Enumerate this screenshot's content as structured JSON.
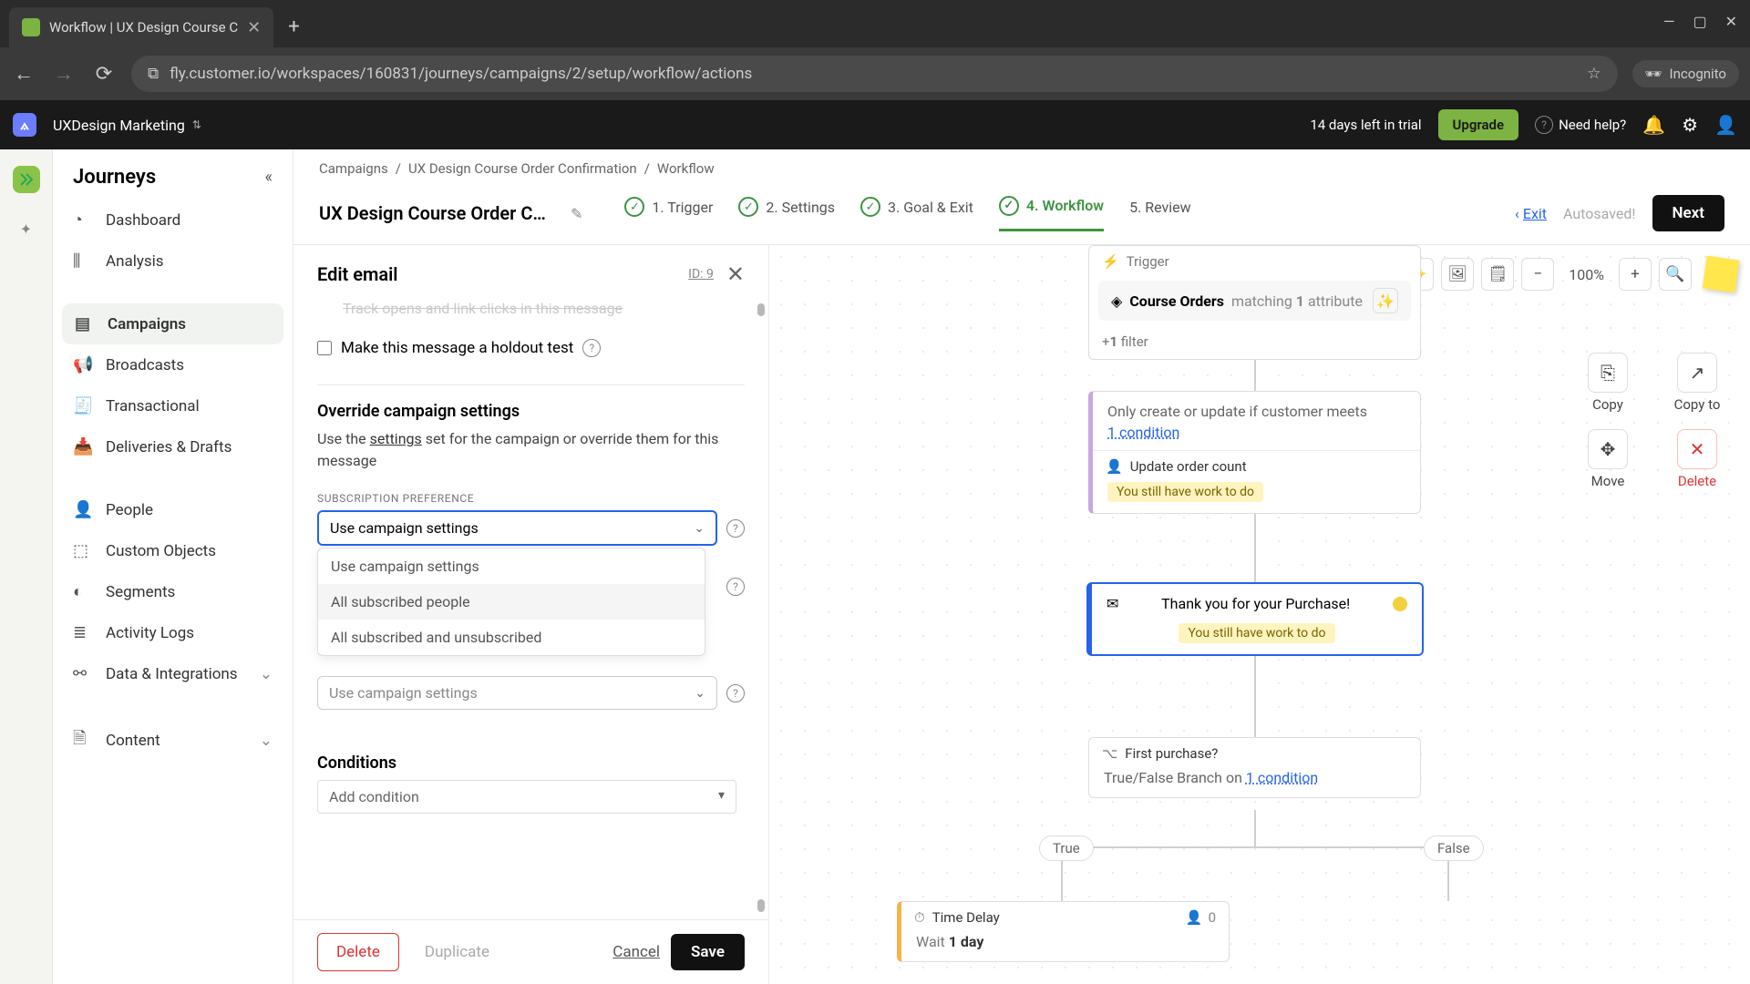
{
  "browser": {
    "tab_title": "Workflow | UX Design Course C",
    "url": "fly.customer.io/workspaces/160831/journeys/campaigns/2/setup/workflow/actions",
    "incognito": "Incognito"
  },
  "topbar": {
    "workspace": "UXDesign Marketing",
    "trial": "14 days left in trial",
    "upgrade": "Upgrade",
    "help": "Need help?"
  },
  "sidebar": {
    "panel_title": "Journeys",
    "items": [
      {
        "label": "Dashboard"
      },
      {
        "label": "Analysis"
      },
      {
        "label": "Campaigns"
      },
      {
        "label": "Broadcasts"
      },
      {
        "label": "Transactional"
      },
      {
        "label": "Deliveries & Drafts"
      },
      {
        "label": "People"
      },
      {
        "label": "Custom Objects"
      },
      {
        "label": "Segments"
      },
      {
        "label": "Activity Logs"
      },
      {
        "label": "Data & Integrations"
      },
      {
        "label": "Content"
      }
    ]
  },
  "breadcrumb": {
    "a": "Campaigns",
    "b": "UX Design Course Order Confirmation",
    "c": "Workflow"
  },
  "page": {
    "title": "UX Design Course Order Confir…",
    "steps": [
      "1. Trigger",
      "2. Settings",
      "3. Goal & Exit",
      "4. Workflow",
      "5. Review"
    ],
    "exit": "Exit",
    "autosaved": "Autosaved!",
    "next": "Next"
  },
  "edit": {
    "title": "Edit email",
    "id": "ID: 9",
    "truncated": "Track opens and link clicks in this message",
    "holdout_label": "Make this message a holdout test",
    "override_title": "Override campaign settings",
    "override_desc_pre": "Use the ",
    "override_desc_link": "settings",
    "override_desc_post": " set for the campaign or override them for this message",
    "sub_pref_label": "SUBSCRIPTION PREFERENCE",
    "select_value": "Use campaign settings",
    "options": [
      "Use campaign settings",
      "All subscribed people",
      "All subscribed and unsubscribed"
    ],
    "second_select": "Use campaign settings",
    "conditions_title": "Conditions",
    "add_condition": "Add condition",
    "delete": "Delete",
    "duplicate": "Duplicate",
    "cancel": "Cancel",
    "save": "Save"
  },
  "canvas": {
    "zoom": "100%",
    "trigger": {
      "title": "Trigger",
      "pill": "Course Orders",
      "matching_pre": "matching ",
      "matching_n": "1",
      "matching_post": " attribute",
      "filter_pre": "+",
      "filter_n": "1",
      "filter_post": " filter"
    },
    "update": {
      "line1_pre": "Only create or update if customer meets",
      "cond": "1 condition",
      "line2": "Update order count",
      "badge": "You still have work to do"
    },
    "email": {
      "title": "Thank you for your Purchase!",
      "badge": "You still have work to do"
    },
    "branch": {
      "title": "First purchase?",
      "desc_pre": "True/False Branch on ",
      "desc_link": "1 condition",
      "true": "True",
      "false": "False"
    },
    "delay": {
      "title": "Time Delay",
      "count": "0",
      "wait_pre": "Wait ",
      "wait_b": "1 day"
    },
    "actions": {
      "copy": "Copy",
      "copyto": "Copy to",
      "move": "Move",
      "delete": "Delete"
    }
  }
}
